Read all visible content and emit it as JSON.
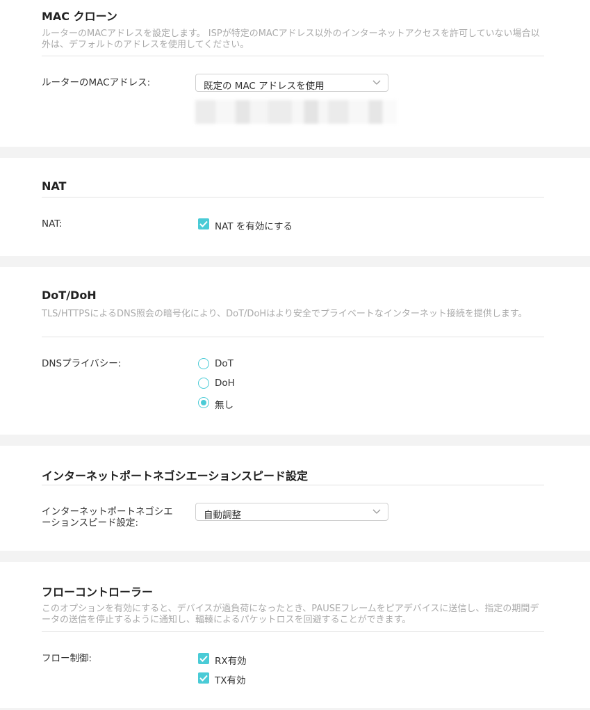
{
  "mac_clone": {
    "title": "MAC クローン",
    "description": "ルーターのMACアドレスを設定します。 ISPが特定のMACアドレス以外のインターネットアクセスを許可していない場合以外は、デフォルトのアドレスを使用してください。",
    "field_label": "ルーターのMACアドレス:",
    "select_value": "既定の MAC アドレスを使用"
  },
  "nat": {
    "title": "NAT",
    "field_label": "NAT:",
    "checkbox_label": "NAT を有効にする",
    "checked": true
  },
  "dot_doh": {
    "title": "DoT/DoH",
    "description": "TLS/HTTPSによるDNS照会の暗号化により、DoT/DoHはより安全でプライベートなインターネット接続を提供します。",
    "field_label": "DNSプライバシー:",
    "options": [
      "DoT",
      "DoH",
      "無し"
    ],
    "selected": "無し"
  },
  "port_speed": {
    "title": "インターネットポートネゴシエーションスピード設定",
    "field_label": "インターネットポートネゴシエーションスピード設定:",
    "select_value": "自動調整"
  },
  "flow_control": {
    "title": "フローコントローラー",
    "description": "このオプションを有効にすると、デバイスが過負荷になったとき、PAUSEフレームをピアデバイスに送信し、指定の期間データの送信を停止するように通知し、輻輳によるパケットロスを回避することができます。",
    "field_label": "フロー制御:",
    "options": [
      {
        "label": "RX有効",
        "checked": true
      },
      {
        "label": "TX有効",
        "checked": true
      }
    ]
  },
  "colors": {
    "accent": "#4acbd6",
    "page_background": "#f3f3f3",
    "description_text": "#aaaaaa"
  }
}
